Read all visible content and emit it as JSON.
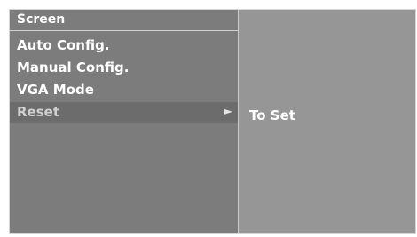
{
  "screen_menu": {
    "title": "Screen",
    "items": [
      {
        "label": "Auto Config.",
        "selected": false
      },
      {
        "label": "Manual Config.",
        "selected": false
      },
      {
        "label": "VGA Mode",
        "selected": false
      },
      {
        "label": "Reset",
        "selected": true
      }
    ],
    "submenu_arrow": "►"
  },
  "submenu": {
    "label": "To Set"
  },
  "colors": {
    "panel_left": "#7c7c7c",
    "panel_right": "#969696",
    "selected_row": "#6c6c6c",
    "text": "#ffffff"
  }
}
